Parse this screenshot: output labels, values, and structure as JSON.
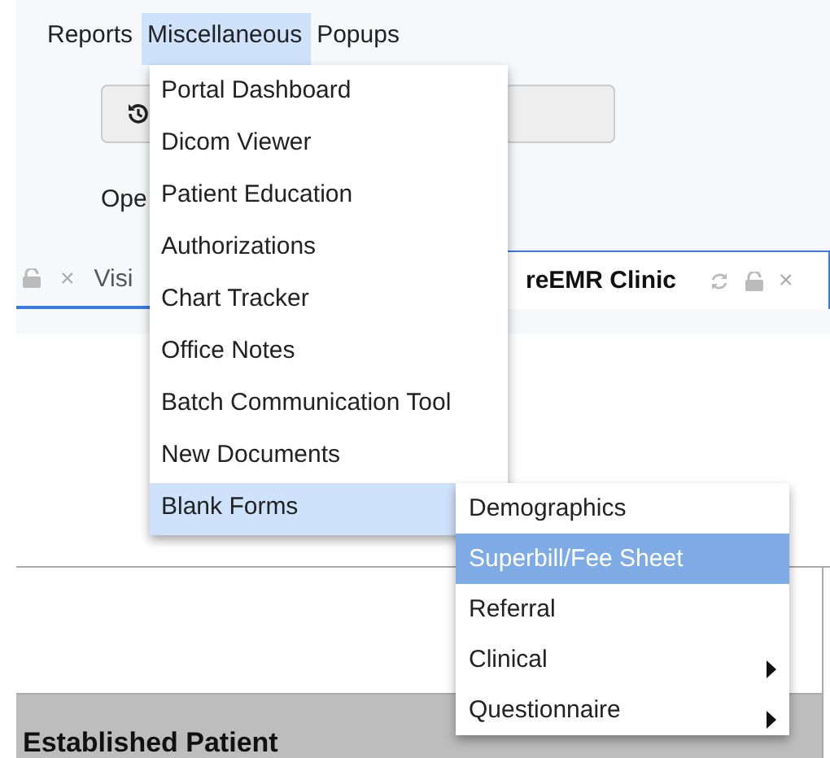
{
  "menubar": [
    {
      "label": "Reports",
      "selected": false
    },
    {
      "label": "Miscellaneous",
      "selected": true
    },
    {
      "label": "Popups",
      "selected": false
    }
  ],
  "open_label": "Ope",
  "tabs": [
    {
      "label": "Visi",
      "selected": false,
      "close": "×"
    },
    {
      "label": "reEMR Clinic",
      "selected": true,
      "close": "×"
    }
  ],
  "dropdown": {
    "items": [
      {
        "label": "Portal Dashboard",
        "selected": false
      },
      {
        "label": "Dicom Viewer",
        "selected": false
      },
      {
        "label": "Patient Education",
        "selected": false
      },
      {
        "label": "Authorizations",
        "selected": false
      },
      {
        "label": "Chart Tracker",
        "selected": false
      },
      {
        "label": "Office Notes",
        "selected": false
      },
      {
        "label": "Batch Communication Tool",
        "selected": false
      },
      {
        "label": "New Documents",
        "selected": false
      },
      {
        "label": "Blank Forms",
        "selected": true
      }
    ]
  },
  "submenu": {
    "items": [
      {
        "label": "Demographics",
        "selected": false,
        "has_submenu": false
      },
      {
        "label": "Superbill/Fee Sheet",
        "selected": true,
        "has_submenu": false
      },
      {
        "label": "Referral",
        "selected": false,
        "has_submenu": false
      },
      {
        "label": "Clinical",
        "selected": false,
        "has_submenu": true
      },
      {
        "label": "Questionnaire",
        "selected": false,
        "has_submenu": true
      }
    ]
  },
  "section_header": "Established Patient"
}
